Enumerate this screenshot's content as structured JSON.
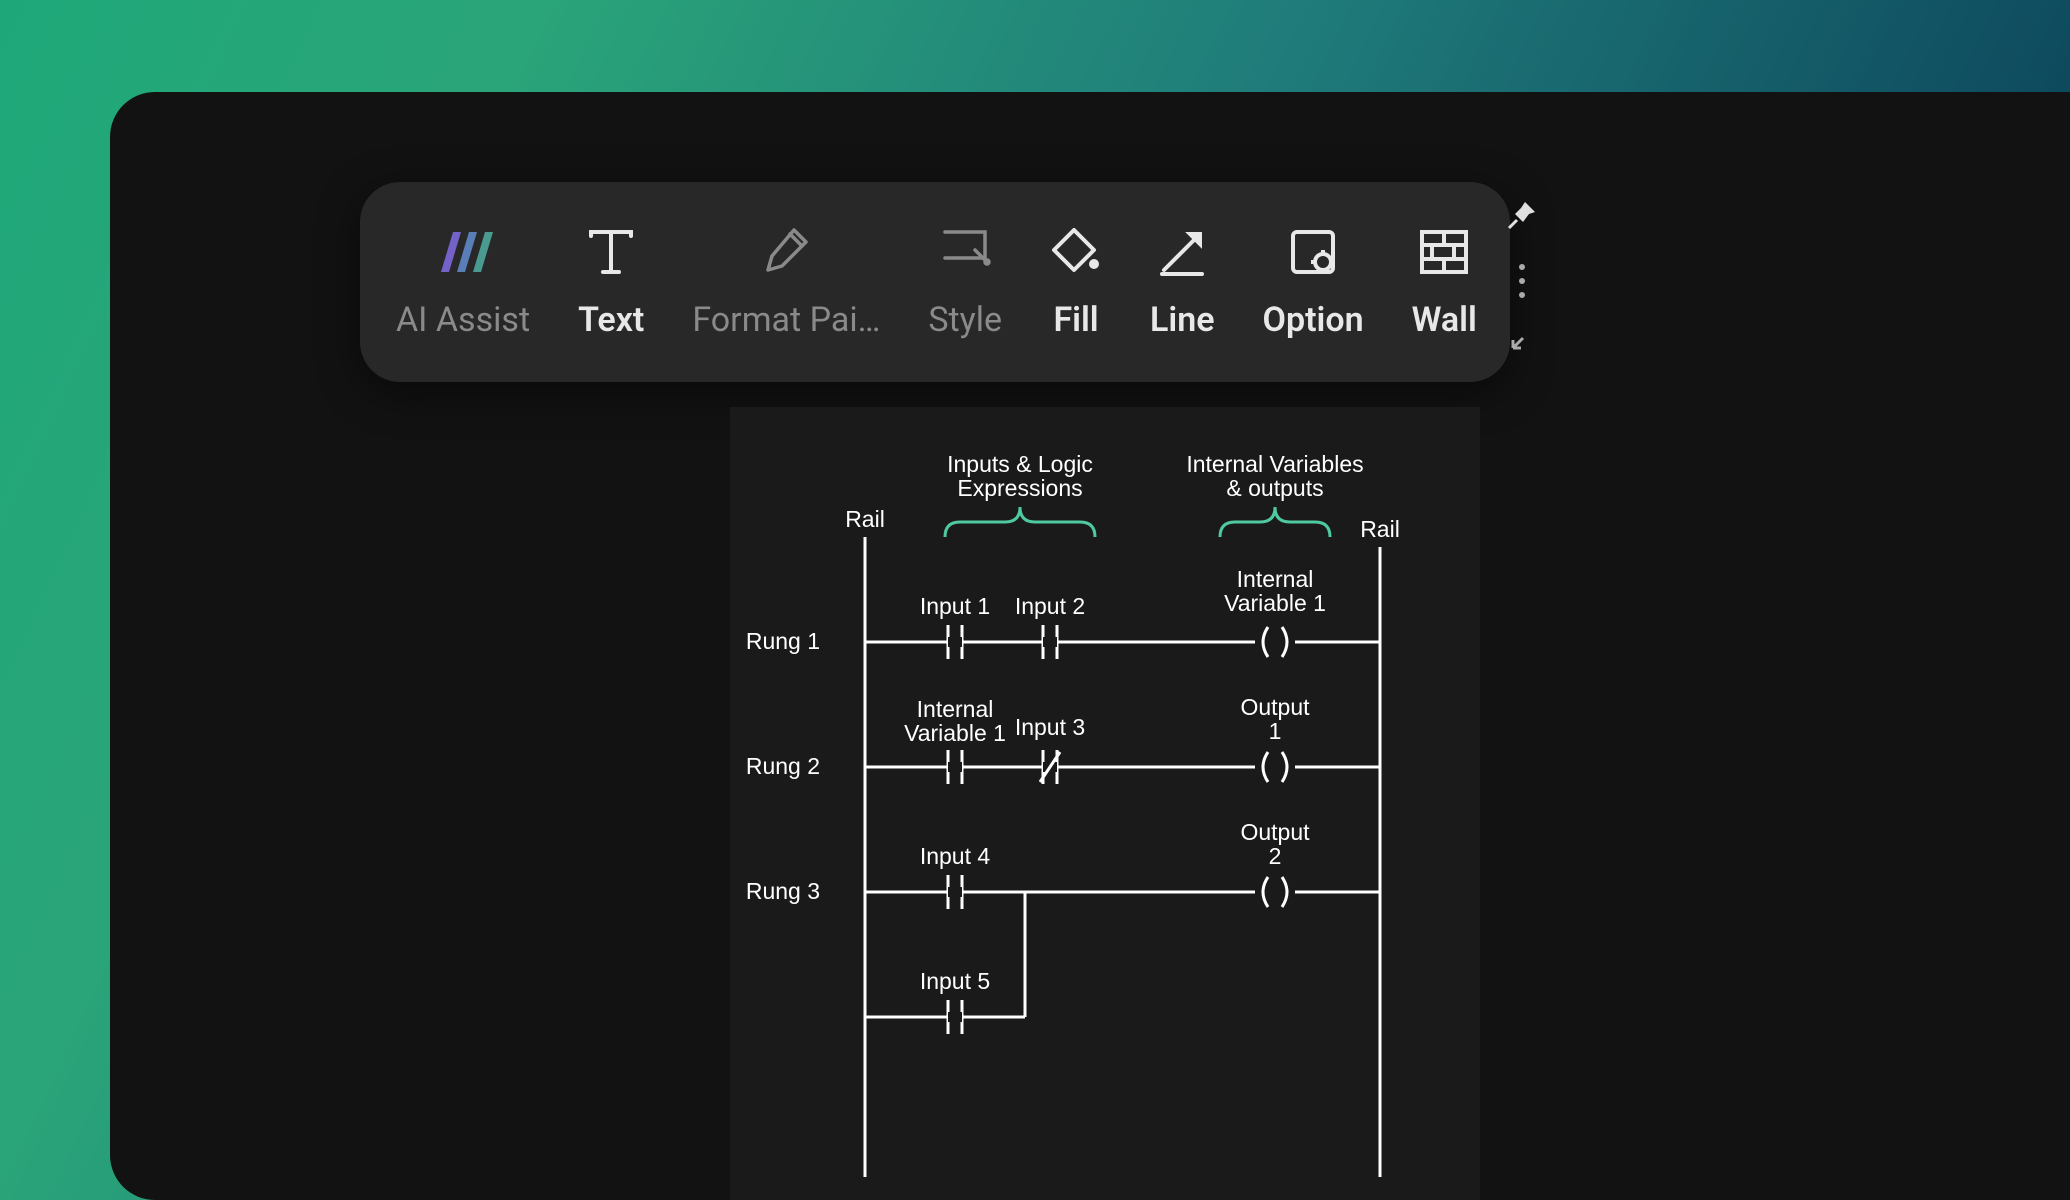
{
  "toolbar": {
    "items": [
      {
        "id": "ai-assist",
        "label": "AI Assist",
        "icon": "ai-assist-icon",
        "dim": true
      },
      {
        "id": "text",
        "label": "Text",
        "icon": "text-icon",
        "bold": true
      },
      {
        "id": "format-painter",
        "label": "Format Pai…",
        "icon": "format-painter-icon",
        "dim": true
      },
      {
        "id": "style",
        "label": "Style",
        "icon": "style-icon",
        "dim": true
      },
      {
        "id": "fill",
        "label": "Fill",
        "icon": "fill-icon",
        "bold": true
      },
      {
        "id": "line",
        "label": "Line",
        "icon": "line-icon",
        "bold": true
      },
      {
        "id": "option",
        "label": "Option",
        "icon": "option-icon",
        "bold": true
      },
      {
        "id": "wall",
        "label": "Wall",
        "icon": "wall-icon",
        "bold": true
      }
    ]
  },
  "diagram": {
    "header_left": "Inputs & Logic\nExpressions",
    "header_right": "Internal Variables\n& outputs",
    "rail_left": "Rail",
    "rail_right": "Rail",
    "rungs": [
      {
        "label": "Rung 1",
        "inputs": [
          {
            "label": "Input 1",
            "type": "no"
          },
          {
            "label": "Input 2",
            "type": "no"
          }
        ],
        "output": {
          "label": "Internal\nVariable 1",
          "type": "coil"
        }
      },
      {
        "label": "Rung 2",
        "inputs": [
          {
            "label": "Internal\nVariable 1",
            "type": "no"
          },
          {
            "label": "Input 3",
            "type": "nc"
          }
        ],
        "output": {
          "label": "Output\n1",
          "type": "coil"
        }
      },
      {
        "label": "Rung 3",
        "inputs": [
          {
            "label": "Input 4",
            "type": "no"
          }
        ],
        "parallel": {
          "label": "Input 5",
          "type": "no"
        },
        "output": {
          "label": "Output\n2",
          "type": "coil"
        }
      }
    ]
  }
}
